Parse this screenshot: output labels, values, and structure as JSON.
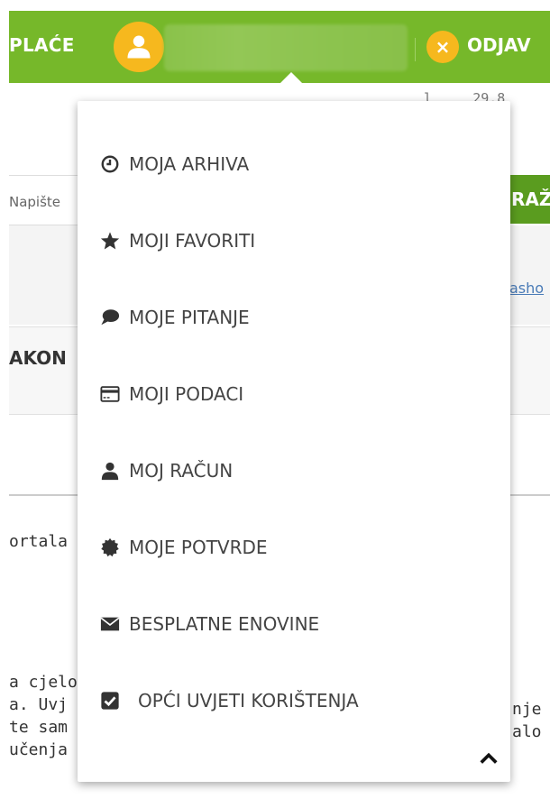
{
  "header": {
    "brand": "PLAĆE",
    "logout_label": "ODJAV"
  },
  "page": {
    "date_fragment": "29.8",
    "date_prefix": "l",
    "search_placeholder": "Napište",
    "search_button": "RAŽ",
    "link_fragment": "asho",
    "law_heading": "AKON",
    "text_fragments": {
      "portal": "ortala",
      "line1_left": "a cjelo",
      "line2_left": "a. Uvj",
      "line3_left": "te sam",
      "line4_left": "učenja",
      "line2_right": "nje",
      "line3_right": "alo"
    }
  },
  "dropdown": {
    "items": [
      {
        "label": "MOJA ARHIVA",
        "icon": "clock-icon"
      },
      {
        "label": "MOJI FAVORITI",
        "icon": "star-icon"
      },
      {
        "label": "MOJE PITANJE",
        "icon": "speech-bubble-icon"
      },
      {
        "label": "MOJI PODACI",
        "icon": "credit-card-icon"
      },
      {
        "label": "MOJ RAČUN",
        "icon": "user-icon"
      },
      {
        "label": "MOJE POTVRDE",
        "icon": "certificate-icon"
      },
      {
        "label": "BESPLATNE ENOVINE",
        "icon": "envelope-icon"
      },
      {
        "label": "OPĆI UVJETI KORIŠTENJA",
        "icon": "checkbox-icon"
      }
    ],
    "collapse_icon": "chevron-up-icon"
  },
  "colors": {
    "header_green": "#76b82a",
    "accent_yellow": "#f6b81e",
    "button_green": "#5a9c1f"
  }
}
